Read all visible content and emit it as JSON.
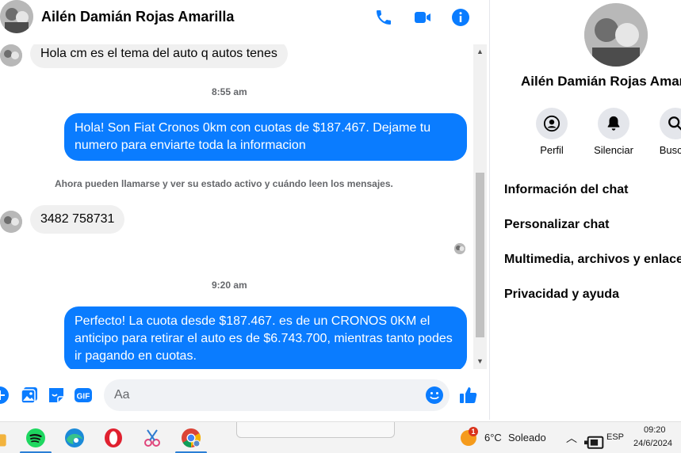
{
  "header": {
    "contact_name": "Ailén Damián Rojas Amarilla",
    "icons": [
      "phone-icon",
      "video-icon",
      "info-icon"
    ],
    "accent_color": "#0a7cff"
  },
  "messages": {
    "incoming_1": "Hola cm es el tema del auto q autos tenes",
    "time_1": "8:55 am",
    "outgoing_1": "Hola! Son Fiat Cronos 0km con cuotas de $187.467. Dejame tu numero para enviarte toda la informacion",
    "system_notice": "Ahora pueden llamarse y ver su estado activo y cuándo leen los mensajes.",
    "incoming_2": "3482 758731",
    "time_2": "9:20 am",
    "outgoing_2": "Perfecto! La cuota desde $187.467. es de un CRONOS 0KM el anticipo para retirar el auto es de $6.743.700, mientras tanto podes ir pagando en cuotas."
  },
  "composer": {
    "placeholder": "Aa",
    "icons": [
      "plus-icon",
      "image-icon",
      "sticker-icon",
      "gif-icon",
      "emoji-icon",
      "thumbs-up-icon"
    ],
    "gif_label": "GIF"
  },
  "panel": {
    "name": "Ailén Damián Rojas Amarilla",
    "actions": [
      {
        "label": "Perfil",
        "icon": "profile-icon"
      },
      {
        "label": "Silenciar",
        "icon": "bell-icon"
      },
      {
        "label": "Buscar",
        "icon": "search-icon"
      }
    ],
    "menu": [
      "Información del chat",
      "Personalizar chat",
      "Multimedia, archivos y enlaces",
      "Privacidad y ayuda"
    ]
  },
  "taskbar": {
    "apps": [
      "spotify-icon",
      "edge-icon",
      "opera-icon",
      "snipping-icon",
      "chrome-icon"
    ],
    "weather_badge": "1",
    "weather_temp": "6°C",
    "weather_desc": "Soleado",
    "language": "ESP",
    "time": "09:20",
    "date": "24/6/2024"
  }
}
